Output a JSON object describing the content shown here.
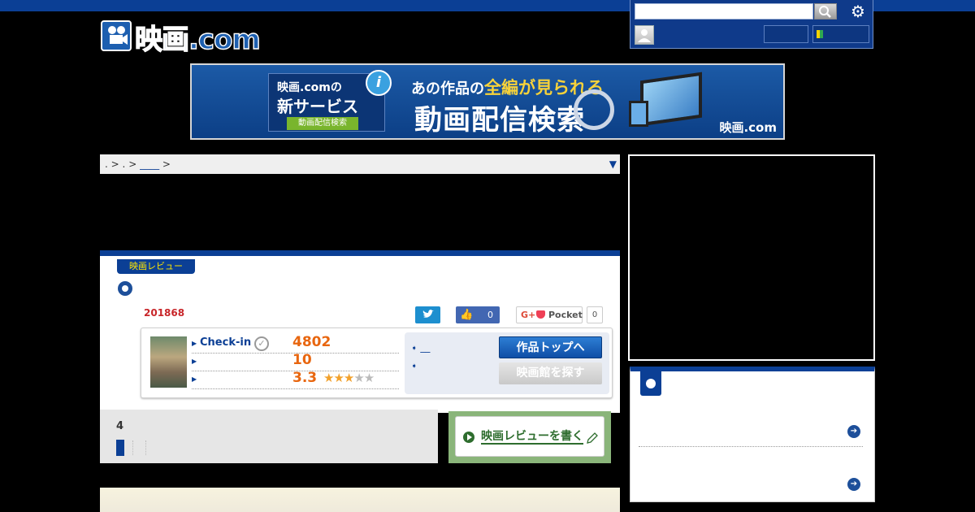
{
  "header": {
    "logo_text": "映画.com",
    "search_placeholder": "",
    "login_label": "",
    "signup_label": ""
  },
  "banner": {
    "badge_line1": "映画.comの",
    "badge_line2": "新サービス",
    "badge_sub": "動画配信検索",
    "headline_small": "あの作品の",
    "headline_highlight": "全編が見られる",
    "headline_big": "動画配信検索",
    "logo_small": "映画.com"
  },
  "breadcrumb": {
    "items": [
      ".",
      ">",
      ".",
      ">",
      "____",
      ">"
    ],
    "arrow": "▼"
  },
  "review": {
    "tab_label": "映画レビュー",
    "count": "201868",
    "like_count": "0",
    "pocket_label": "Pocket",
    "pocket_count": "0",
    "gplus_label": "G+",
    "stats": [
      {
        "label": "Check-in",
        "value": "4802"
      },
      {
        "label": "",
        "value": "10"
      },
      {
        "label": "",
        "value": "3.3"
      }
    ],
    "rating": 3.3,
    "links": [
      "__",
      ""
    ],
    "btn_top": "作品トップへ",
    "btn_theater": "映画館を探す"
  },
  "pagination": {
    "count": "4"
  },
  "write_review": {
    "label": "映画レビューを書く"
  },
  "colors": {
    "brand_blue": "#0b3f95",
    "accent_orange": "#e8660f",
    "count_red": "#c8262a",
    "write_green": "#8ab57a"
  }
}
